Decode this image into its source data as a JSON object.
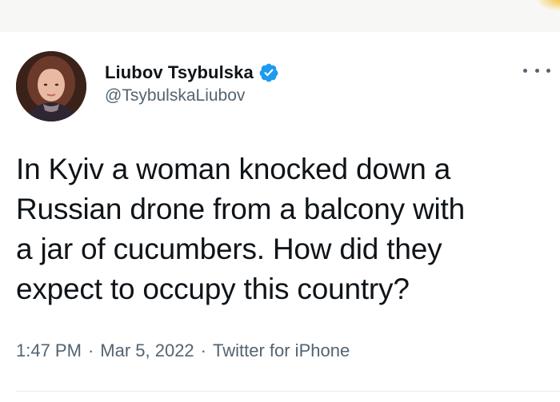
{
  "tweet": {
    "author": {
      "display_name": "Liubov Tsybulska",
      "handle": "@TsybulskaLiubov",
      "verified": true,
      "avatar_icon": "avatar-photo"
    },
    "text": "In Kyiv a woman knocked down a\nRussian drone from a balcony with\na jar of cucumbers. How did they\nexpect to occupy this country?",
    "time": "1:47 PM",
    "date": "Mar 5, 2022",
    "source": "Twitter for iPhone",
    "separator": "·",
    "more_icon": "more-horizontal-icon"
  },
  "colors": {
    "text": "#0f1419",
    "secondary": "#536471",
    "verified": "#1d9bf0"
  }
}
